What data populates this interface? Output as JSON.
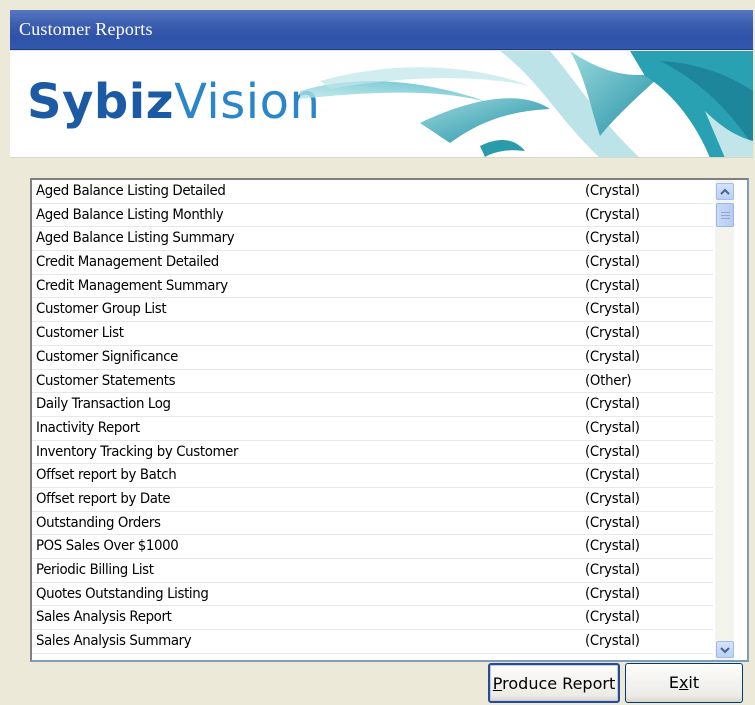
{
  "window": {
    "title": "Customer Reports"
  },
  "banner": {
    "brand_primary": "Sybiz",
    "brand_secondary": "Vision"
  },
  "reports": [
    {
      "name": "Aged Balance Listing Detailed",
      "type": "(Crystal)"
    },
    {
      "name": "Aged Balance Listing Monthly",
      "type": "(Crystal)"
    },
    {
      "name": "Aged Balance Listing Summary",
      "type": "(Crystal)"
    },
    {
      "name": "Credit Management Detailed",
      "type": "(Crystal)"
    },
    {
      "name": "Credit Management Summary",
      "type": "(Crystal)"
    },
    {
      "name": "Customer Group List",
      "type": "(Crystal)"
    },
    {
      "name": "Customer List",
      "type": "(Crystal)"
    },
    {
      "name": "Customer Significance",
      "type": "(Crystal)"
    },
    {
      "name": "Customer Statements",
      "type": "(Other)"
    },
    {
      "name": "Daily Transaction Log",
      "type": "(Crystal)"
    },
    {
      "name": "Inactivity Report",
      "type": "(Crystal)"
    },
    {
      "name": "Inventory Tracking by Customer",
      "type": "(Crystal)"
    },
    {
      "name": "Offset report by Batch",
      "type": "(Crystal)"
    },
    {
      "name": "Offset report by Date",
      "type": "(Crystal)"
    },
    {
      "name": "Outstanding Orders",
      "type": "(Crystal)"
    },
    {
      "name": "POS Sales Over $1000",
      "type": "(Crystal)"
    },
    {
      "name": "Periodic Billing List",
      "type": "(Crystal)"
    },
    {
      "name": "Quotes Outstanding Listing",
      "type": "(Crystal)"
    },
    {
      "name": "Sales Analysis Report",
      "type": "(Crystal)"
    },
    {
      "name": "Sales Analysis Summary",
      "type": "(Crystal)"
    }
  ],
  "buttons": {
    "produce_mnemonic": "P",
    "produce_rest": "roduce Report",
    "exit_first": "E",
    "exit_mnemonic": "x",
    "exit_rest": "it"
  },
  "icons": {
    "scroll_up": "chevron-up-icon",
    "scroll_down": "chevron-down-icon"
  },
  "colors": {
    "title_bar": "#3d5fb0",
    "brand_dark": "#1c5aa6",
    "brand_light": "#2a85c9",
    "banner_art": "#2aa1b3"
  }
}
